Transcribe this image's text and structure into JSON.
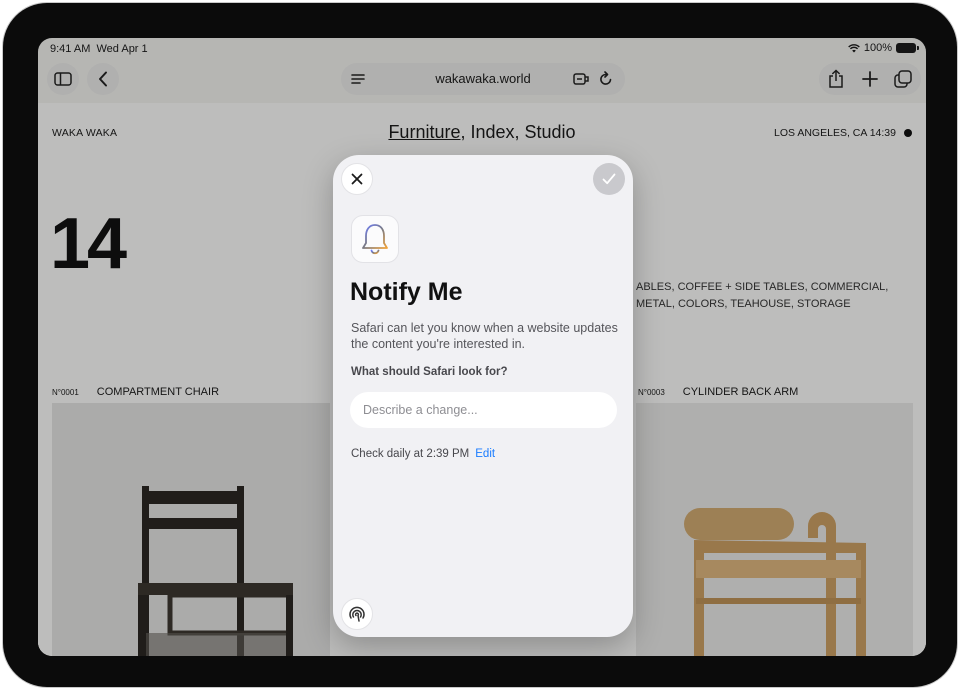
{
  "status_bar": {
    "time": "9:41 AM",
    "date": "Wed Apr 1",
    "battery": "100%"
  },
  "toolbar": {
    "url": "wakawaka.world",
    "icons": [
      "sidebar-icon",
      "back-icon",
      "reader-icon",
      "extension-icon",
      "reload-icon",
      "share-icon",
      "plus-icon",
      "tabs-icon"
    ]
  },
  "page": {
    "brand": "WAKA WAKA",
    "title_link": "Furniture",
    "title_rest": ", Index, Studio",
    "location": "LOS ANGELES, CA 14:39",
    "big_number": "14",
    "categories_line1": "ABLES,  COFFEE + SIDE TABLES,  COMMERCIAL,",
    "categories_line2": "METAL,  COLORS,  TEAHOUSE,  STORAGE",
    "products": [
      {
        "number": "N°0001",
        "name": "COMPARTMENT CHAIR"
      },
      {
        "number": "N°0003",
        "name": "CYLINDER BACK ARM"
      }
    ]
  },
  "sheet": {
    "title": "Notify Me",
    "description": "Safari can let you know when a website updates the content you're interested in.",
    "question": "What should Safari look for?",
    "input_placeholder": "Describe a change...",
    "input_value": "",
    "schedule": "Check daily at 2:39 PM",
    "edit_label": "Edit"
  }
}
